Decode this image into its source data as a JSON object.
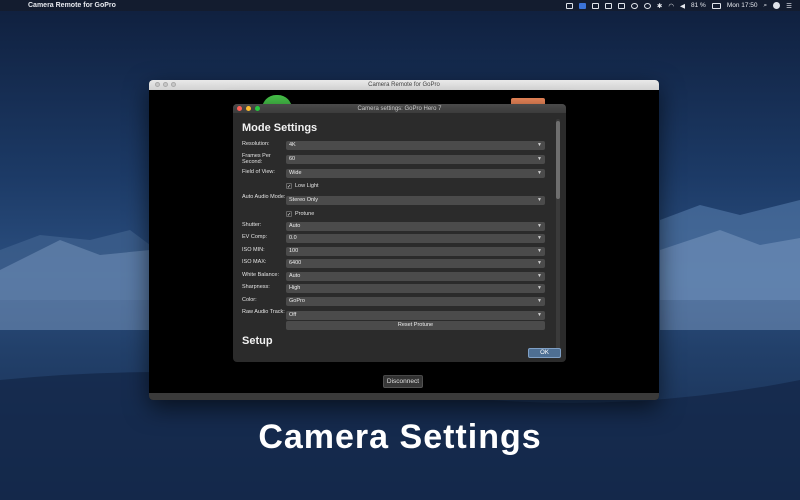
{
  "menubar": {
    "app_name": "Camera Remote for GoPro",
    "battery": "81 %",
    "clock": "Mon 17:50",
    "icons": [
      "screen-mirror-icon",
      "app-icon",
      "display-icon",
      "window-icon",
      "copy-icon",
      "dropbox-icon",
      "time-machine-icon",
      "bluetooth-icon",
      "wifi-icon",
      "volume-icon",
      "battery-icon",
      "search-icon",
      "user-icon",
      "menu-icon"
    ]
  },
  "main_window": {
    "title": "Camera Remote for GoPro",
    "disconnect_label": "Disconnect"
  },
  "dialog": {
    "title": "Camera settings: GoPro Hero 7",
    "section_mode": "Mode Settings",
    "section_setup": "Setup",
    "fields": [
      {
        "label": "Resolution:",
        "value": "4K"
      },
      {
        "label": "Frames Per Second:",
        "value": "60"
      },
      {
        "label": "Field of View:",
        "value": "Wide"
      },
      {
        "label": "Auto Audio Mode:",
        "value": "Stereo Only"
      },
      {
        "label": "Shutter:",
        "value": "Auto"
      },
      {
        "label": "EV Comp:",
        "value": "0.0"
      },
      {
        "label": "ISO MIN:",
        "value": "100"
      },
      {
        "label": "ISO MAX:",
        "value": "6400"
      },
      {
        "label": "White Balance:",
        "value": "Auto"
      },
      {
        "label": "Sharpness:",
        "value": "High"
      },
      {
        "label": "Color:",
        "value": "GoPro"
      },
      {
        "label": "Raw Audio Track:",
        "value": "Off"
      }
    ],
    "checkboxes": [
      {
        "label": "Low Light",
        "checked": true
      },
      {
        "label": "Protune",
        "checked": true
      }
    ],
    "reset_label": "Reset Protune",
    "ok_label": "OK"
  },
  "caption": "Camera Settings"
}
